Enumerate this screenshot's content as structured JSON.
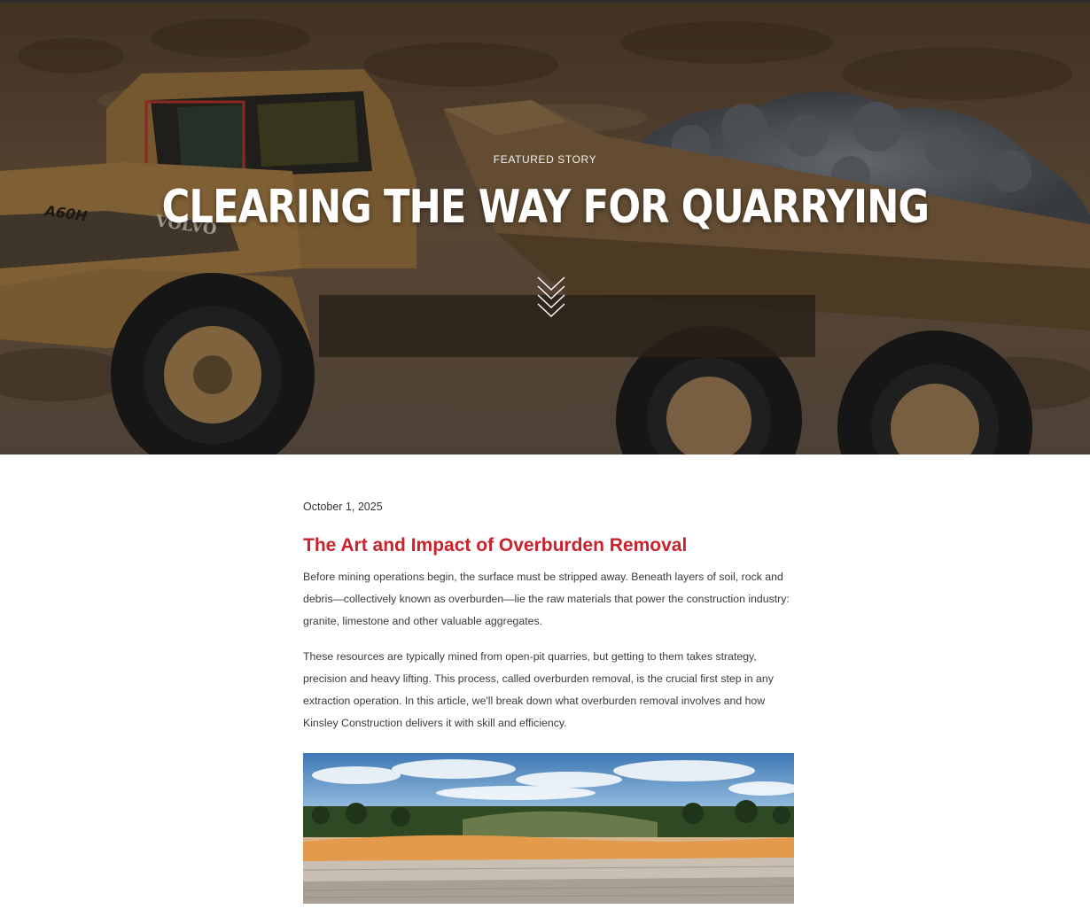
{
  "hero": {
    "kicker": "FEATURED STORY",
    "title": "CLEARING THE WAY FOR QUARRYING",
    "truck_model_text": "A60H",
    "truck_brand_text": "VOLVO",
    "scroll_icon": "triple-chevron-down-icon"
  },
  "article": {
    "date": "October 1, 2025",
    "heading": "The Art and Impact of Overburden Removal",
    "paragraphs": [
      "Before mining operations begin, the surface must be stripped away. Beneath layers of soil, rock and debris—collectively known as overburden—lie the raw materials that power the construction industry: granite, limestone and other valuable aggregates.",
      "These resources are typically mined from open-pit quarries, but getting to them takes strategy, precision and heavy lifting. This process, called overburden removal, is the crucial first step in any extraction operation. In this article, we'll break down what overburden removal involves and how Kinsley Construction delivers it with skill and efficiency."
    ]
  },
  "colors": {
    "heading_red": "#c8232c",
    "body_text": "#3a3a3a",
    "hero_text": "#ffffff"
  }
}
